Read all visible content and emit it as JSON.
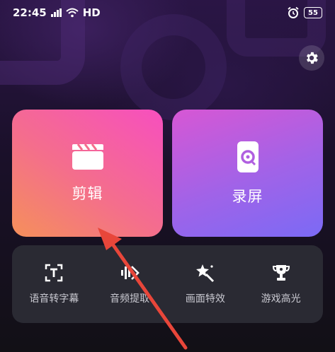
{
  "status": {
    "time": "22:45",
    "network": "HD",
    "battery": "55"
  },
  "settings": {
    "icon": "gear-icon"
  },
  "cards": {
    "edit": {
      "label": "剪辑",
      "icon": "clapperboard-icon"
    },
    "record": {
      "label": "录屏",
      "icon": "phone-record-icon"
    }
  },
  "tools": [
    {
      "label": "语音转字幕",
      "icon": "text-recognition-icon"
    },
    {
      "label": "音频提取",
      "icon": "audio-extract-icon"
    },
    {
      "label": "画面特效",
      "icon": "magic-wand-icon"
    },
    {
      "label": "游戏高光",
      "icon": "trophy-icon"
    }
  ],
  "colors": {
    "edit_gradient_start": "#f5905a",
    "edit_gradient_end": "#f74fbf",
    "record_gradient_start": "#d757d4",
    "record_gradient_end": "#7b6af5",
    "tools_bg": "#2a2a33",
    "annotation_arrow": "#e8463a"
  }
}
